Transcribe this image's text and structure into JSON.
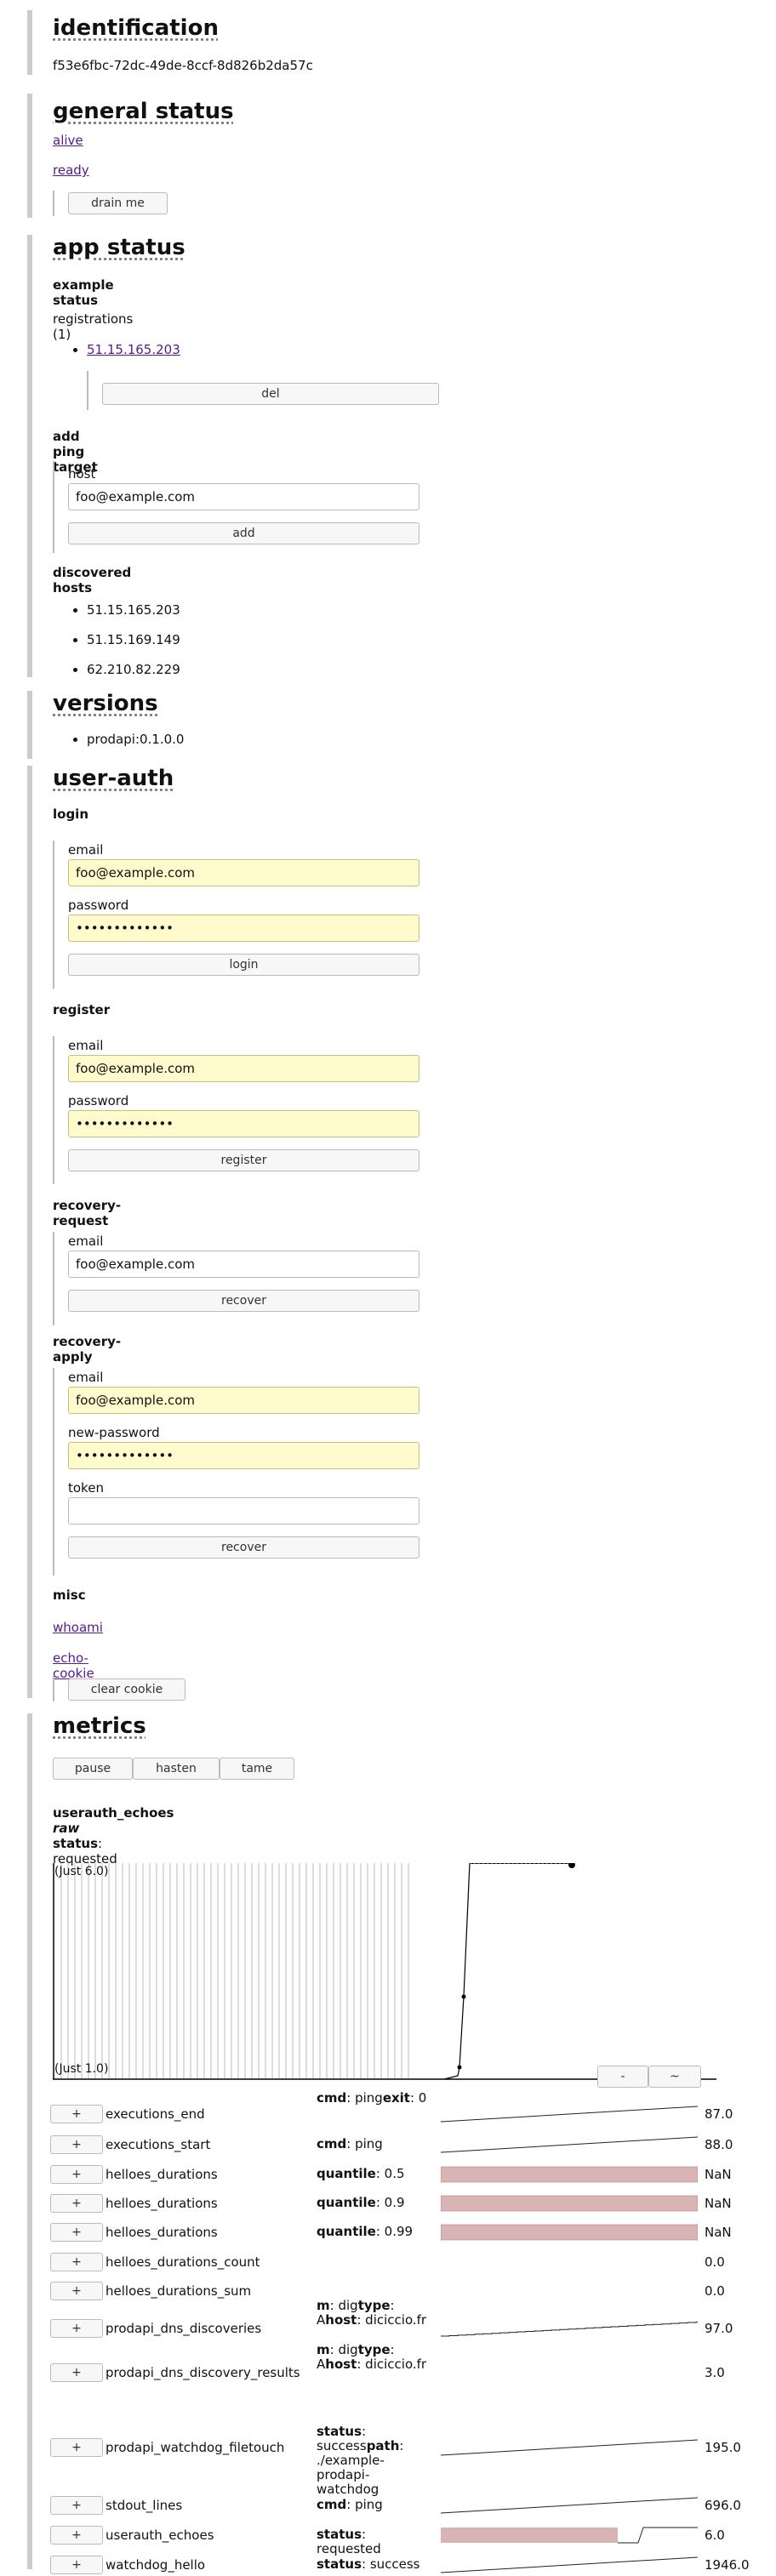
{
  "identification": {
    "title": "identification",
    "id": "f53e6fbc-72dc-49de-8ccf-8d826b2da57c"
  },
  "general_status": {
    "title": "general status",
    "alive": "alive",
    "ready": "ready",
    "drain_button": "drain me"
  },
  "app_status": {
    "title": "app status",
    "example_status": "example status",
    "registrations": "registrations (1)",
    "registration_items": [
      "51.15.165.203"
    ],
    "del_button": "del",
    "add_ping_target": "add ping target",
    "host_label": "host",
    "host_value": "foo@example.com",
    "add_button": "add",
    "discovered_hosts": "discovered hosts",
    "hosts": [
      "51.15.165.203",
      "51.15.169.149",
      "62.210.82.229"
    ]
  },
  "versions": {
    "title": "versions",
    "items": [
      "prodapi:0.1.0.0"
    ]
  },
  "user_auth": {
    "title": "user-auth",
    "login": {
      "title": "login",
      "email_label": "email",
      "email_value": "foo@example.com",
      "password_label": "password",
      "password_value": "•••••••••••••",
      "button": "login"
    },
    "register": {
      "title": "register",
      "email_label": "email",
      "email_value": "foo@example.com",
      "password_label": "password",
      "password_value": "•••••••••••••",
      "button": "register"
    },
    "recovery_request": {
      "title": "recovery-request",
      "email_label": "email",
      "email_value": "foo@example.com",
      "button": "recover"
    },
    "recovery_apply": {
      "title": "recovery-apply",
      "email_label": "email",
      "email_value": "foo@example.com",
      "new_password_label": "new-password",
      "new_password_value": "•••••••••••••",
      "token_label": "token",
      "token_value": "",
      "button": "recover"
    },
    "misc": {
      "title": "misc",
      "whoami": "whoami",
      "echo_cookie": "echo-cookie",
      "clear_button": "clear cookie"
    }
  },
  "metrics": {
    "title": "metrics",
    "buttons": [
      "pause",
      "hasten",
      "tame"
    ],
    "chart_title": "userauth_echoes",
    "chart_title_suffix": "raw",
    "status_key": "status",
    "status_value": ": requested",
    "chart_top_label": "(Just 6.0)",
    "chart_bottom_label": "(Just 1.0)",
    "chart_buttons": [
      "-",
      "~"
    ],
    "plus": "+",
    "rows": [
      {
        "name": "executions_end",
        "labels": [
          [
            "cmd",
            ": ping"
          ],
          [
            "exit",
            ": 0"
          ]
        ],
        "value": "87.0",
        "spark": "line"
      },
      {
        "name": "executions_start",
        "labels": [
          [
            "cmd",
            ": ping"
          ]
        ],
        "value": "88.0",
        "spark": "line"
      },
      {
        "name": "helloes_durations",
        "labels": [
          [
            "quantile",
            ": 0.5"
          ]
        ],
        "value": "NaN",
        "spark": "fill"
      },
      {
        "name": "helloes_durations",
        "labels": [
          [
            "quantile",
            ": 0.9"
          ]
        ],
        "value": "NaN",
        "spark": "fill"
      },
      {
        "name": "helloes_durations",
        "labels": [
          [
            "quantile",
            ": 0.99"
          ]
        ],
        "value": "NaN",
        "spark": "fill"
      },
      {
        "name": "helloes_durations_count",
        "labels": [],
        "value": "0.0",
        "spark": "none"
      },
      {
        "name": "helloes_durations_sum",
        "labels": [],
        "value": "0.0",
        "spark": "none"
      },
      {
        "name": "prodapi_dns_discoveries",
        "labels": [
          [
            "m",
            ": dig"
          ],
          [
            "type",
            ": A"
          ],
          [
            "host",
            ": diciccio.fr"
          ]
        ],
        "value": "97.0",
        "spark": "step"
      },
      {
        "name": "prodapi_dns_discovery_results",
        "labels": [
          [
            "m",
            ": dig"
          ],
          [
            "type",
            ": A"
          ],
          [
            "host",
            ": diciccio.fr"
          ]
        ],
        "value": "3.0",
        "spark": "none"
      },
      {
        "name": "prodapi_watchdog_filetouch",
        "labels": [
          [
            "status",
            ": success"
          ],
          [
            "path",
            ": ./example-prodapi-watchdog"
          ]
        ],
        "value": "195.0",
        "spark": "line"
      },
      {
        "name": "stdout_lines",
        "labels": [
          [
            "cmd",
            ": ping"
          ]
        ],
        "value": "696.0",
        "spark": "line"
      },
      {
        "name": "userauth_echoes",
        "labels": [
          [
            "status",
            ": requested"
          ]
        ],
        "value": "6.0",
        "spark": "partial"
      },
      {
        "name": "watchdog_hello",
        "labels": [
          [
            "status",
            ": success"
          ]
        ],
        "value": "1946.0",
        "spark": "line"
      }
    ]
  }
}
